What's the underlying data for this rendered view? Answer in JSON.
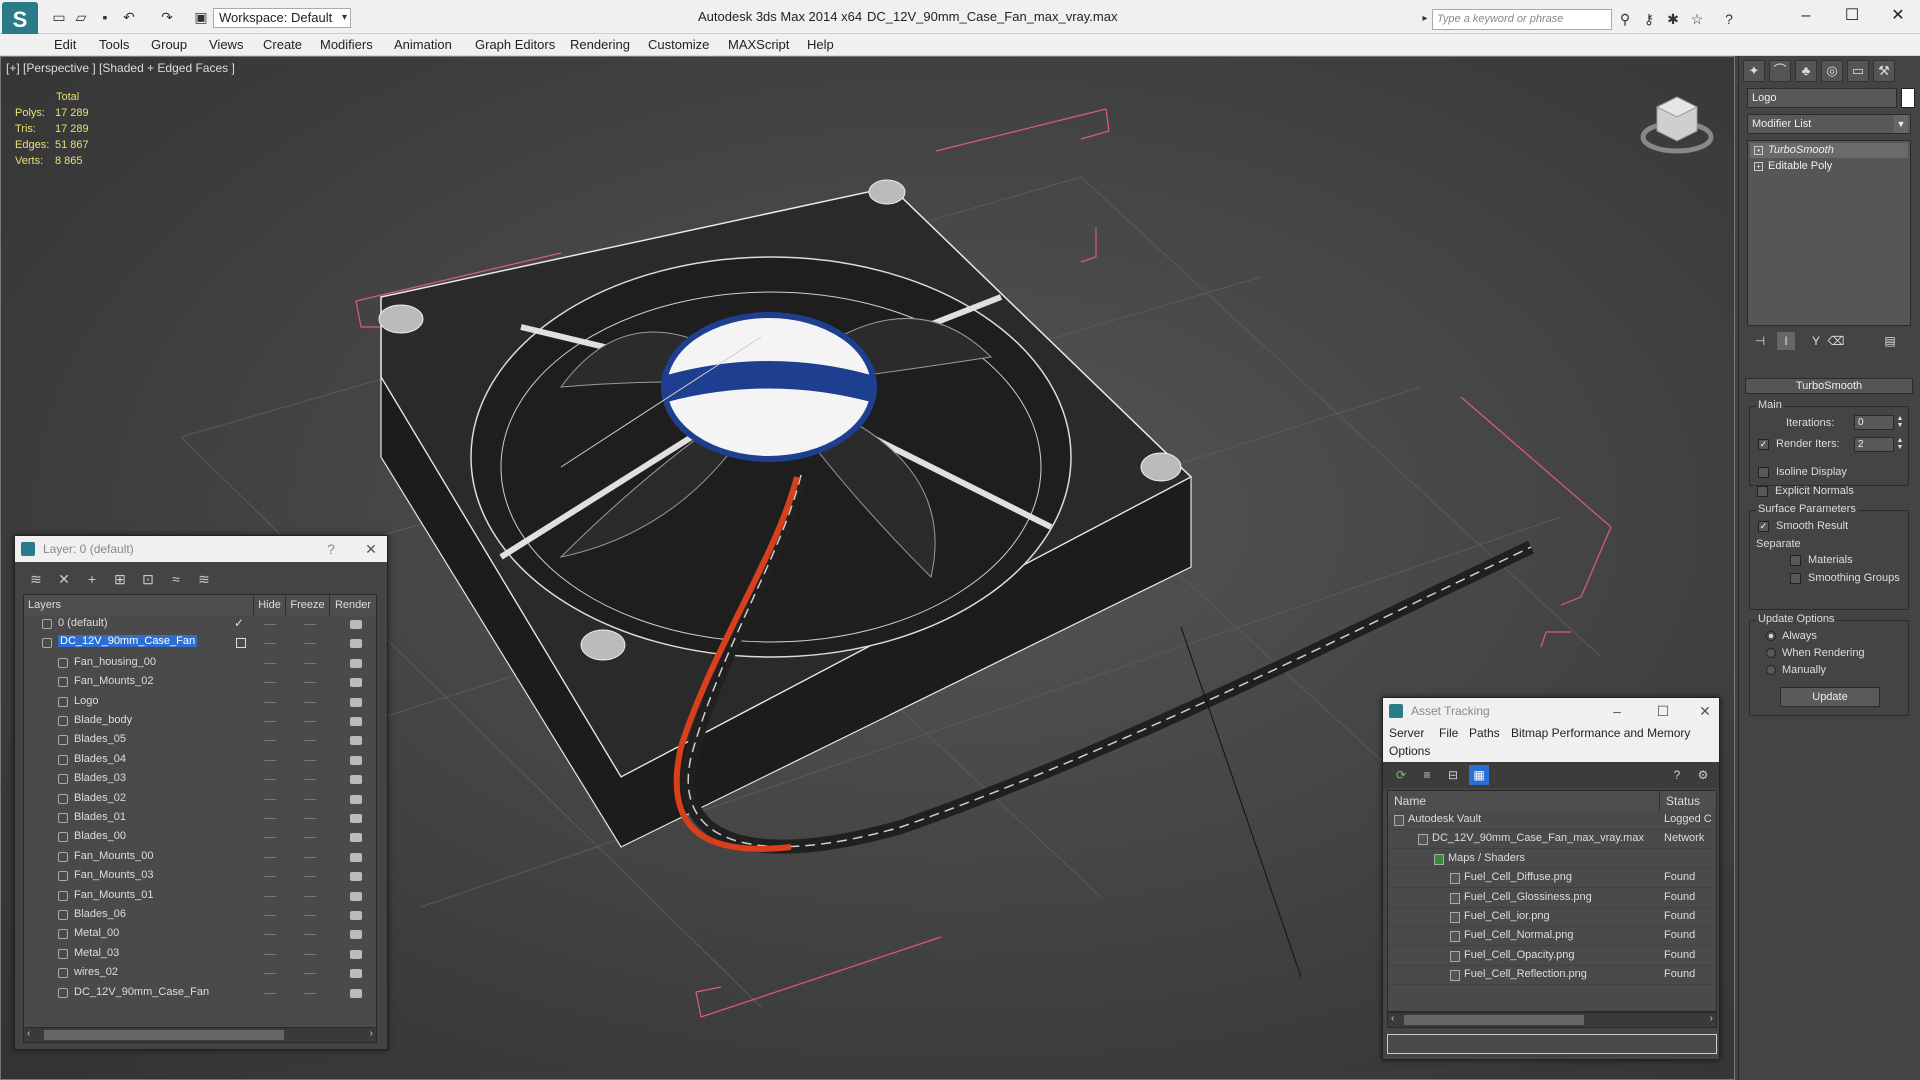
{
  "window": {
    "app_title": "Autodesk 3ds Max  2014 x64",
    "file_title": "DC_12V_90mm_Case_Fan_max_vray.max",
    "workspace": "Workspace: Default",
    "search_placeholder": "Type a keyword or phrase"
  },
  "menu": [
    "Edit",
    "Tools",
    "Group",
    "Views",
    "Create",
    "Modifiers",
    "Animation",
    "Graph Editors",
    "Rendering",
    "Customize",
    "MAXScript",
    "Help"
  ],
  "viewport": {
    "label": "[+] [Perspective ] [Shaded + Edged Faces ]",
    "stats": {
      "header": "Total",
      "rows": [
        {
          "k": "Polys:",
          "v": "17 289"
        },
        {
          "k": "Tris:",
          "v": "17 289"
        },
        {
          "k": "Edges:",
          "v": "51 867"
        },
        {
          "k": "Verts:",
          "v": "8 865"
        }
      ]
    }
  },
  "command_panel": {
    "object_name": "Logo",
    "modifier_list": "Modifier List",
    "stack": [
      "TurboSmooth",
      "Editable Poly"
    ],
    "rollout_title": "TurboSmooth",
    "main_group": "Main",
    "iterations_label": "Iterations:",
    "iterations_value": "0",
    "render_iters_label": "Render Iters:",
    "render_iters_value": "2",
    "isoline": "Isoline Display",
    "explicit_normals": "Explicit Normals",
    "surface_group": "Surface Parameters",
    "smooth_result": "Smooth Result",
    "separate": "Separate",
    "materials": "Materials",
    "smoothing_groups": "Smoothing Groups",
    "update_group": "Update Options",
    "always": "Always",
    "when_rendering": "When Rendering",
    "manually": "Manually",
    "update_button": "Update"
  },
  "layer_dialog": {
    "title": "Layer: 0 (default)",
    "help": "?",
    "close": "✕",
    "columns": [
      "Layers",
      "Hide",
      "Freeze",
      "Render"
    ],
    "layers": [
      "0 (default)",
      "DC_12V_90mm_Case_Fan",
      "Fan_housing_00",
      "Fan_Mounts_02",
      "Logo",
      "Blade_body",
      "Blades_05",
      "Blades_04",
      "Blades_03",
      "Blades_02",
      "Blades_01",
      "Blades_00",
      "Fan_Mounts_00",
      "Fan_Mounts_03",
      "Fan_Mounts_01",
      "Blades_06",
      "Metal_00",
      "Metal_03",
      "wires_02",
      "DC_12V_90mm_Case_Fan"
    ]
  },
  "asset_dialog": {
    "title": "Asset Tracking",
    "menu": [
      "Server",
      "File",
      "Paths",
      "Bitmap Performance and Memory",
      "Options"
    ],
    "columns": [
      "Name",
      "Status"
    ],
    "rows": [
      {
        "name": "Autodesk Vault",
        "status": "Logged C"
      },
      {
        "name": "DC_12V_90mm_Case_Fan_max_vray.max",
        "status": "Network"
      },
      {
        "name": "Maps / Shaders",
        "status": ""
      },
      {
        "name": "Fuel_Cell_Diffuse.png",
        "status": "Found"
      },
      {
        "name": "Fuel_Cell_Glossiness.png",
        "status": "Found"
      },
      {
        "name": "Fuel_Cell_ior.png",
        "status": "Found"
      },
      {
        "name": "Fuel_Cell_Normal.png",
        "status": "Found"
      },
      {
        "name": "Fuel_Cell_Opacity.png",
        "status": "Found"
      },
      {
        "name": "Fuel_Cell_Reflection.png",
        "status": "Found"
      }
    ]
  },
  "colors": {
    "selection": "#2d6fd0",
    "stats_text": "#e8e070",
    "wire_red": "#d8401c",
    "bbox_pink": "#e05a7a"
  }
}
